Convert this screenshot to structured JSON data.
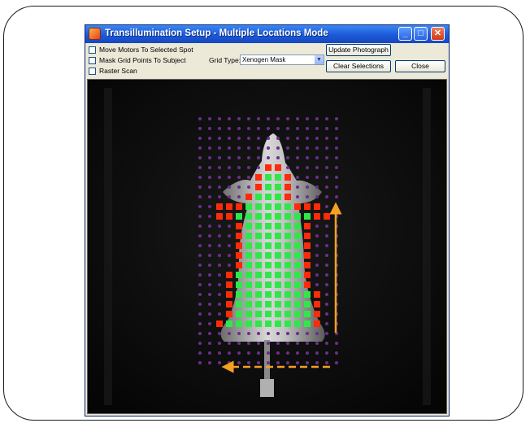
{
  "window": {
    "title": "Transillumination Setup - Multiple Locations Mode",
    "title_buttons": [
      "minimize-icon",
      "maximize-icon",
      "close-icon"
    ]
  },
  "options": {
    "move_motors": "Move Motors To Selected  Spot",
    "mask_grid": "Mask Grid Points To Subject",
    "raster_scan": "Raster Scan"
  },
  "grid_type": {
    "label": "Grid Type:",
    "value": "Xenogen Mask"
  },
  "buttons": {
    "update_photograph": "Update Photograph",
    "clear_selections": "Clear Selections",
    "close": "Close"
  },
  "colors": {
    "grid_point": "#6a2f8a",
    "selected_point": "#2ee84a",
    "masked_point": "#ff2a0a",
    "arrow": "#f5a020",
    "title_bar": "#1c5ad8"
  }
}
